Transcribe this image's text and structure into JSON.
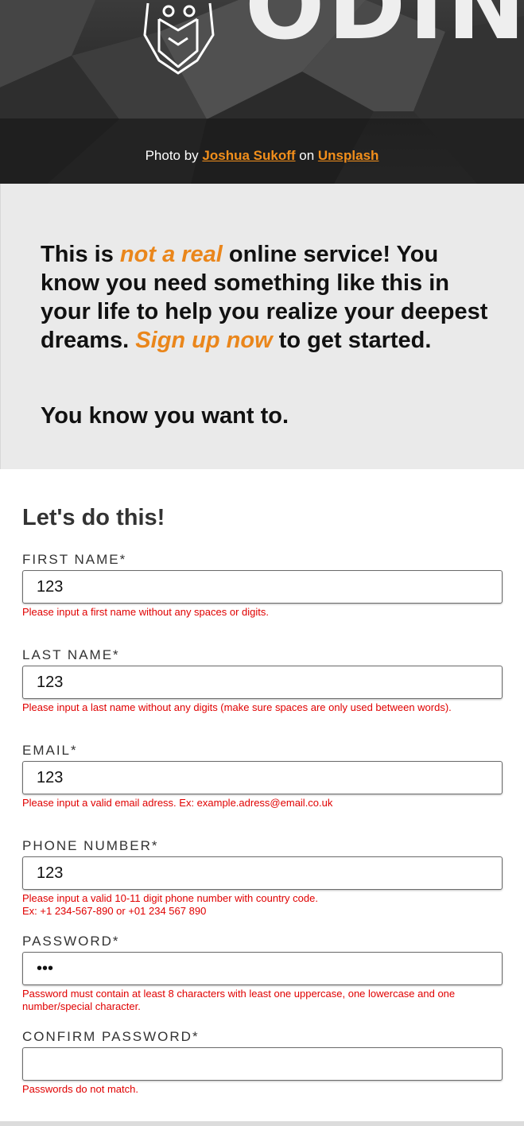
{
  "hero": {
    "logo_text": "ODIN",
    "credit_prefix": "Photo by ",
    "credit_author": "Joshua Sukoff",
    "credit_middle": " on ",
    "credit_site": "Unsplash"
  },
  "intro": {
    "p1_a": "This is ",
    "p1_hl1": "not a real",
    "p1_b": " online service! You know you need something like this in your life to help you realize your deepest dreams. ",
    "p1_hl2": "Sign up now",
    "p1_c": " to get started.",
    "p2": "You know you want to."
  },
  "form": {
    "title": "Let's do this!",
    "fields": [
      {
        "label": "FIRST NAME*",
        "value": "123",
        "error": "Please input a first name without any spaces or digits."
      },
      {
        "label": "LAST NAME*",
        "value": "123",
        "error": "Please input a last name without any digits (make sure spaces are only used between words)."
      },
      {
        "label": "EMAIL*",
        "value": "123",
        "error": "Please input a valid email adress. Ex: example.adress@email.co.uk"
      },
      {
        "label": "PHONE NUMBER*",
        "value": "123",
        "error": "Please input a valid 10-11 digit phone number with country code.\nEx: +1 234-567-890 or +01 234 567 890"
      },
      {
        "label": "PASSWORD*",
        "value": "123",
        "error": "Password must contain at least 8 characters with least one uppercase, one lowercase and one number/special character."
      },
      {
        "label": "CONFIRM PASSWORD*",
        "value": "",
        "error": "Passwords do not match."
      }
    ]
  },
  "colors": {
    "accent": "#ea861b",
    "error": "#e00000",
    "intro_bg": "#eaeaea"
  },
  "icons": {
    "logo": "viking-helmet-icon"
  }
}
